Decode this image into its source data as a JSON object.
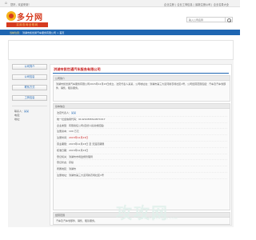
{
  "topbar": {
    "welcome": "您好，欢迎来到！",
    "links": [
      "企业注册",
      "企业工商信息",
      "最新注册公司",
      "企业名录大全"
    ]
  },
  "logo": {
    "text": "多分网",
    "banner": "实用查询全程网"
  },
  "search": {
    "placeholder": "输入公司名称"
  },
  "breadcrumb": {
    "label": "当前位置：",
    "path": "洪湖市凯世通汽车服务有限公司 > 首页"
  },
  "sidebar": {
    "buttons": [
      "公司简介",
      "公司信息",
      "联系方式",
      "工商信息"
    ],
    "contact_label": "联系人：",
    "contact_name": "某某",
    "contact_lines": [
      "电话：",
      "地址："
    ]
  },
  "company": {
    "title": "洪湖市凯世通汽车服务有限公司"
  },
  "intro": {
    "heading": "公司简介",
    "text": "洪湖市凯世通汽车服务有限公司2015年12月23日成立，法定代表人某某，公司地址在：洪湖市第三大道河新农场社区1号，公司经营范围包括：汽车及汽车零部件、销售、租赁服务。"
  },
  "info": {
    "heading": "基本信息",
    "rows": [
      {
        "k": "法定代表人：",
        "v": "某某",
        "style": "link"
      },
      {
        "k": "统一社会信用代码：",
        "v": "91421083MA487XX17",
        "style": ""
      },
      {
        "k": "企业类型：",
        "v": "有限责任公司(自然人投资或控股)",
        "style": ""
      },
      {
        "k": "注册资本：",
        "v": "100 万元",
        "style": ""
      },
      {
        "k": "注册时间：",
        "v": "2015年12月23日",
        "style": "red"
      },
      {
        "k": "营业期限：",
        "v": "2015年12月23日 至 无固定期限",
        "style": ""
      },
      {
        "k": "核准日期：",
        "v": "2015年12月23日",
        "style": ""
      },
      {
        "k": "登记机关：",
        "v": "洪湖市市场监督管理局",
        "style": ""
      },
      {
        "k": "登记状态：",
        "v": "存续",
        "style": ""
      },
      {
        "k": "所属地区：",
        "v": "洪湖市",
        "style": ""
      },
      {
        "k": "注册地址：",
        "v": "洪湖市第三大道河新农场社区1号",
        "style": ""
      }
    ]
  },
  "scope": {
    "heading": "经营范围",
    "text": "汽车及汽车零部件、销售、租赁服务。"
  },
  "watermark": {
    "text": "攻攻网",
    "sub": "WWW.GONGGONG.COM"
  },
  "colors": {
    "brand_blue": "#1f66b2",
    "title_red": "#c81e1e",
    "logo_red": "#d63b1f"
  }
}
